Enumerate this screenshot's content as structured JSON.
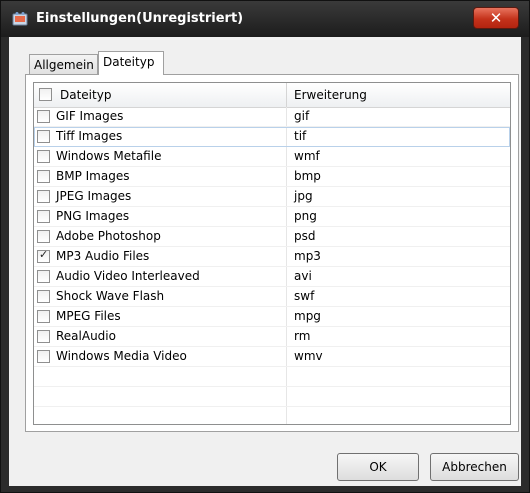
{
  "window": {
    "title": "Einstellungen(Unregistriert)",
    "close_label": "✕"
  },
  "tabs": [
    {
      "label": "Allgemein"
    },
    {
      "label": "Dateityp"
    }
  ],
  "list": {
    "columns": {
      "filetype": "Dateityp",
      "extension": "Erweiterung"
    },
    "rows": [
      {
        "name": "GIF Images",
        "ext": "gif",
        "checked": false
      },
      {
        "name": "Tiff Images",
        "ext": "tif",
        "checked": false,
        "selected": true
      },
      {
        "name": "Windows Metafile",
        "ext": "wmf",
        "checked": false
      },
      {
        "name": "BMP Images",
        "ext": "bmp",
        "checked": false
      },
      {
        "name": "JPEG Images",
        "ext": "jpg",
        "checked": false
      },
      {
        "name": "PNG Images",
        "ext": "png",
        "checked": false
      },
      {
        "name": "Adobe Photoshop",
        "ext": "psd",
        "checked": false
      },
      {
        "name": "MP3 Audio Files",
        "ext": "mp3",
        "checked": true
      },
      {
        "name": "Audio Video Interleaved",
        "ext": "avi",
        "checked": false
      },
      {
        "name": "Shock Wave Flash",
        "ext": "swf",
        "checked": false
      },
      {
        "name": "MPEG Files",
        "ext": "mpg",
        "checked": false
      },
      {
        "name": "RealAudio",
        "ext": "rm",
        "checked": false
      },
      {
        "name": "Windows Media Video",
        "ext": "wmv",
        "checked": false
      }
    ]
  },
  "buttons": {
    "ok": "OK",
    "cancel": "Abbrechen"
  }
}
